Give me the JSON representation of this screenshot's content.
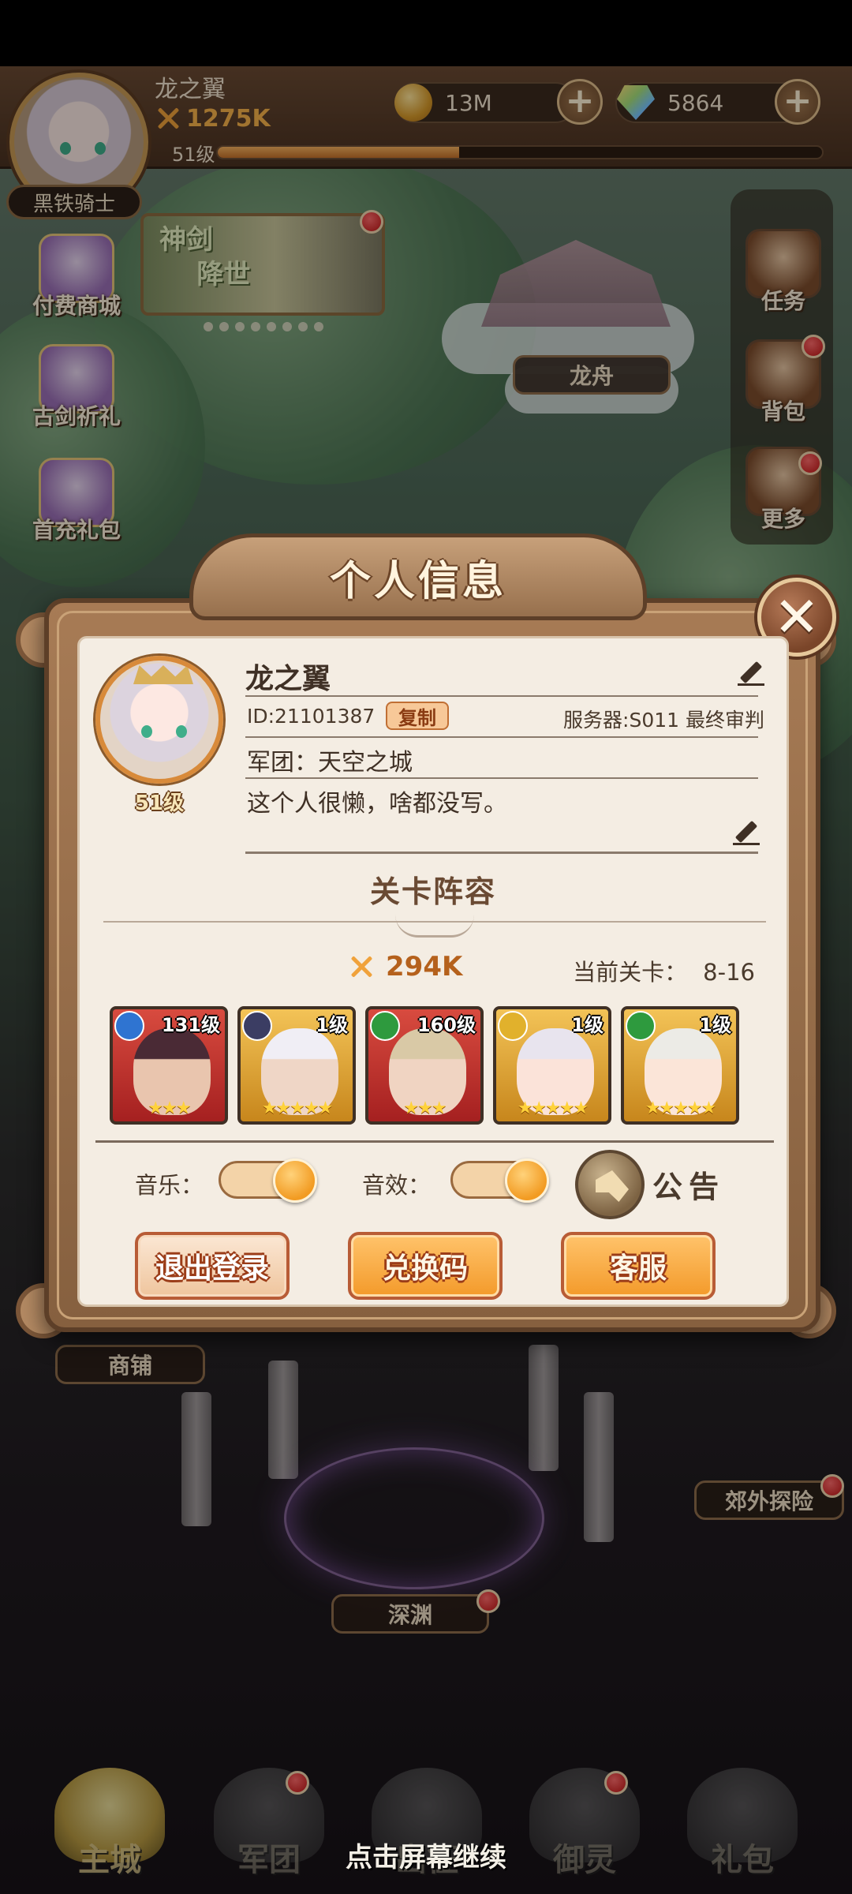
{
  "topbar": {
    "player_name": "龙之翼",
    "power": "1275K",
    "level": "51级",
    "xp_fraction": 0.4,
    "rank_title": "黑铁骑士",
    "gold": "13M",
    "gems": "5864",
    "plus": "+"
  },
  "side_left": [
    {
      "label": "付费商城"
    },
    {
      "label": "古剑祈礼"
    },
    {
      "label": "首充礼包"
    }
  ],
  "side_right": [
    {
      "label": "任务"
    },
    {
      "label": "背包"
    },
    {
      "label": "更多"
    }
  ],
  "banner": {
    "line1": "神剑",
    "line2": "降世"
  },
  "locations": {
    "dragon_boat": "龙舟",
    "shop": "商铺",
    "suburb": "郊外探险",
    "abyss": "深渊"
  },
  "bottom_nav": [
    {
      "label": "主城"
    },
    {
      "label": "军团"
    },
    {
      "label": "出征"
    },
    {
      "label": "御灵"
    },
    {
      "label": "礼包"
    }
  ],
  "continue_hint": "点击屏幕继续",
  "dialog": {
    "title": "个人信息",
    "close": "✕",
    "name": "龙之翼",
    "level": "51级",
    "id": "ID:21101387",
    "copy": "复制",
    "server": "服务器:S011 最终审判",
    "guild": "军团：天空之城",
    "signature": "这个人很懒，啥都没写。",
    "lineup_title": "关卡阵容",
    "power": "294K",
    "stage_label": "当前关卡：",
    "stage_value": "8-16",
    "heroes": [
      {
        "level": "131级",
        "stars": "★★★"
      },
      {
        "level": "1级",
        "stars": "★★★★★"
      },
      {
        "level": "160级",
        "stars": "★★★"
      },
      {
        "level": "1级",
        "stars": "★★★★★"
      },
      {
        "level": "1级",
        "stars": "★★★★★"
      }
    ],
    "music_label": "音乐：",
    "sfx_label": "音效：",
    "notice_label": "公告",
    "logout": "退出登录",
    "redeem": "兑换码",
    "service": "客服"
  }
}
